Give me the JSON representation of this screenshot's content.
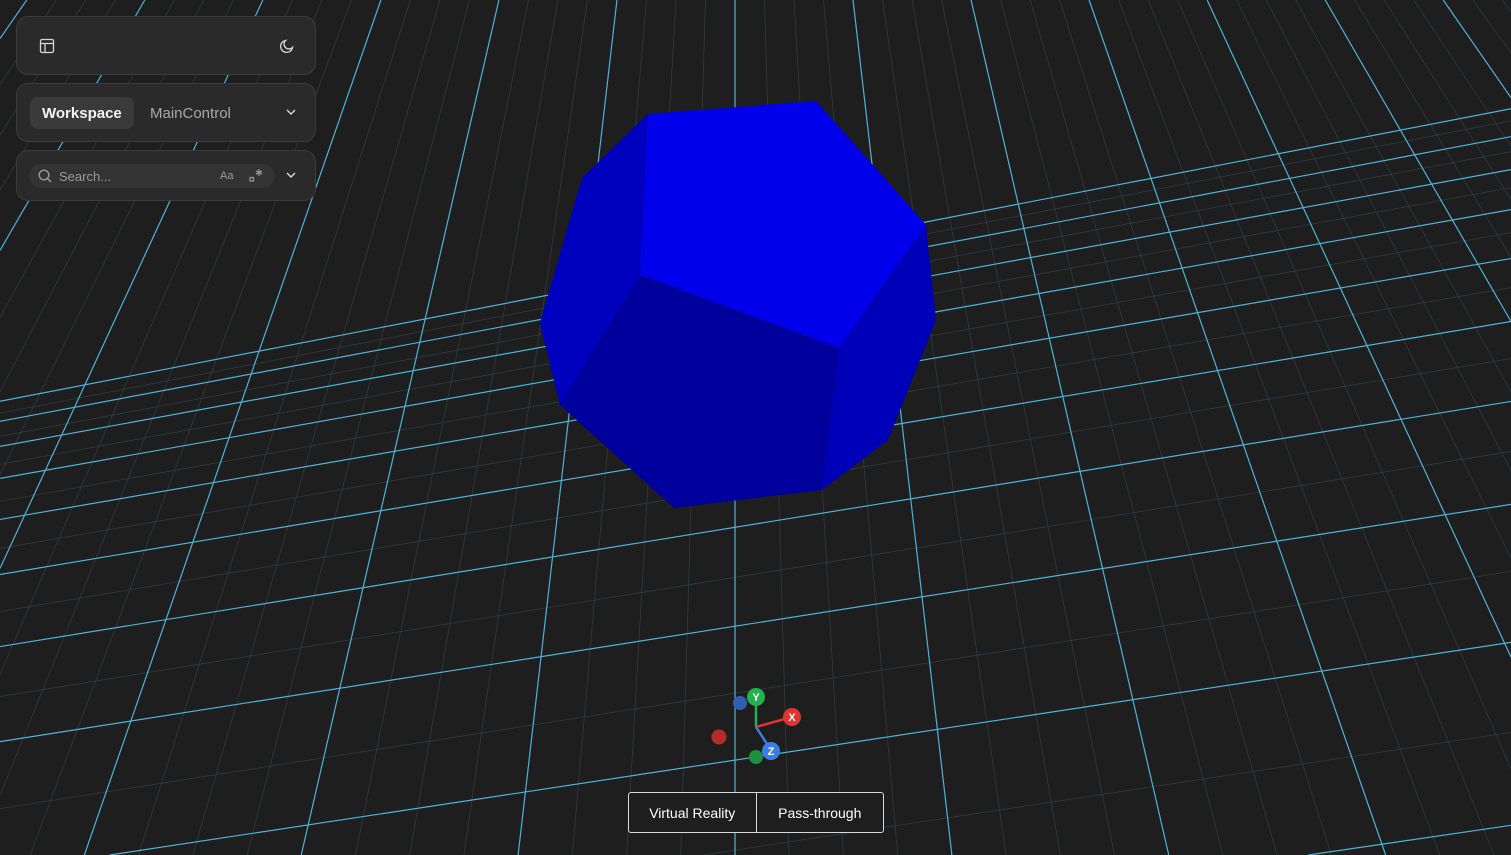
{
  "toolbar": {
    "layout_icon": "layout-panel-icon",
    "theme_icon": "moon-icon"
  },
  "tabs": {
    "items": [
      {
        "label": "Workspace",
        "active": true
      },
      {
        "label": "MainControl",
        "active": false
      }
    ],
    "dropdown_icon": "chevron-down-icon"
  },
  "search": {
    "placeholder": "Search...",
    "value": "",
    "match_case_label": "Aa",
    "regex_icon": "regex-icon",
    "dropdown_icon": "chevron-down-icon"
  },
  "viewport": {
    "background": "#1e1e1e",
    "grid_color": "#4fb3d9",
    "shape": "truncated-polyhedron",
    "shape_color": "#0000cc"
  },
  "gizmo": {
    "x_label": "X",
    "y_label": "Y",
    "z_label": "Z",
    "x_color": "#e03434",
    "y_color": "#22b14c",
    "z_color": "#3b7de8"
  },
  "modes": {
    "virtual_reality": "Virtual Reality",
    "pass_through": "Pass-through"
  }
}
